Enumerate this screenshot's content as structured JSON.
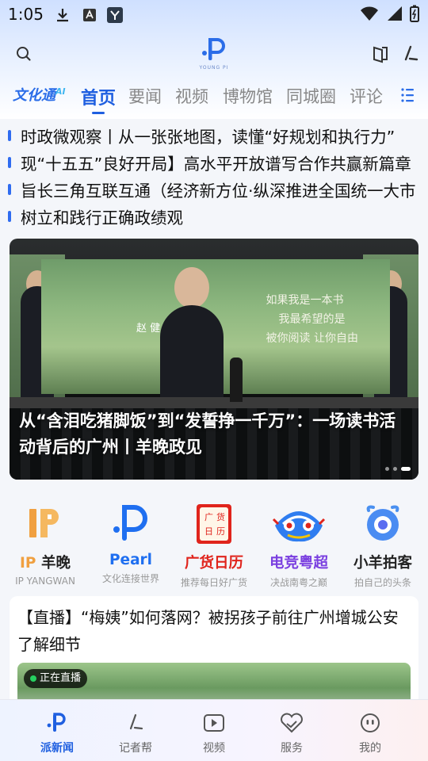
{
  "status_bar": {
    "time": "1:05"
  },
  "header": {
    "logo_text": "YOUNG PI"
  },
  "tabs": {
    "brand": "文化通",
    "brand_sup": "AI",
    "items": [
      "首页",
      "要闻",
      "视频",
      "博物馆",
      "同城圈",
      "评论"
    ]
  },
  "headlines": [
    "时政微观察丨从一张张地图，读懂“好规划和执行力”",
    "现“十五五”良好开局】高水平开放谱写合作共赢新篇章",
    "旨长三角互联互通（经济新方位·纵深推进全国统一大市",
    "树立和践行正确政绩观"
  ],
  "banner": {
    "caption": "从“含泪吃猪脚饭”到“发誓挣一千万”：一场读书活动背后的广州丨羊晚政见",
    "screen_text": [
      "如果我是一本书",
      "我最希望的是",
      "被你阅读 让你自由"
    ],
    "screen_name": "赵 健"
  },
  "services": [
    {
      "title_prefix": "IP ",
      "title": "羊晚",
      "subtitle": "IP YANGWAN",
      "color": "#f0a040"
    },
    {
      "title_prefix": "P",
      "title": "earl",
      "subtitle": "文化连接世界",
      "color": "#1f6ff0"
    },
    {
      "title_prefix": "",
      "title": "广货日历",
      "subtitle": "推荐每日好广货",
      "color": "#e0241c"
    },
    {
      "title_prefix": "",
      "title": "电竞粤超",
      "subtitle": "决战南粤之巅",
      "color": "#7a3fe0"
    },
    {
      "title_prefix": "",
      "title": "小羊拍客",
      "subtitle": "拍自己的头条",
      "color": "#222222"
    }
  ],
  "calendar_icon_text": "广货日历",
  "card": {
    "title": "【直播】“梅姨”如何落网？被拐孩子前往广州增城公安了解细节",
    "live_badge": "正在直播"
  },
  "bottom_nav": {
    "active_index": 0,
    "items": [
      "派新闻",
      "记者帮",
      "视频",
      "服务",
      "我的"
    ]
  },
  "colors": {
    "accent": "#1f5fe0"
  }
}
